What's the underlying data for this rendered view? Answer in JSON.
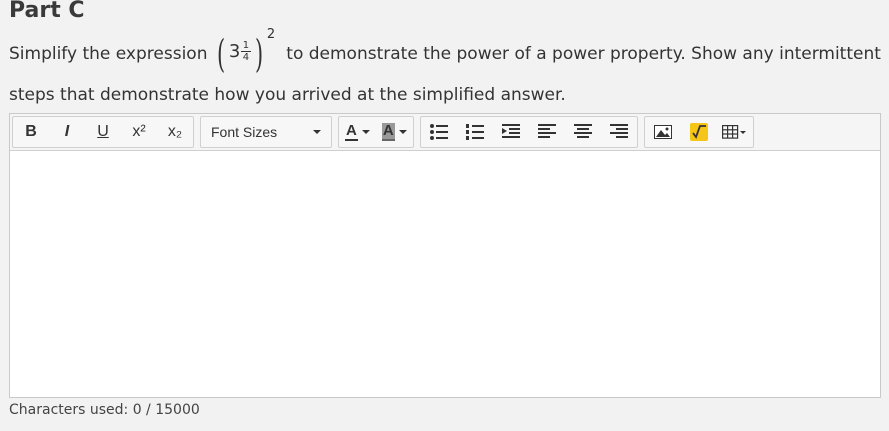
{
  "part_title": "Part C",
  "prompt": {
    "before": "Simplify the expression",
    "after": "to demonstrate the power of a power property. Show any intermittent steps that demonstrate how you arrived at the simplified answer.",
    "math": {
      "whole": "3",
      "numerator": "1",
      "denominator": "4",
      "exponent": "2"
    }
  },
  "toolbar": {
    "bold": "B",
    "italic": "I",
    "underline": "U",
    "superscript": "x²",
    "subscript": "x₂",
    "font_sizes_label": "Font Sizes",
    "font_color": "A",
    "bg_color": "A",
    "icons": [
      "bold-icon",
      "italic-icon",
      "underline-icon",
      "superscript-icon",
      "subscript-icon",
      "bullet-list-icon",
      "numbered-list-icon",
      "indent-icon",
      "align-left-icon",
      "align-center-icon",
      "align-right-icon",
      "image-icon",
      "equation-icon",
      "table-icon"
    ]
  },
  "editor": {
    "value": ""
  },
  "character_count": "Characters used: 0 / 15000"
}
